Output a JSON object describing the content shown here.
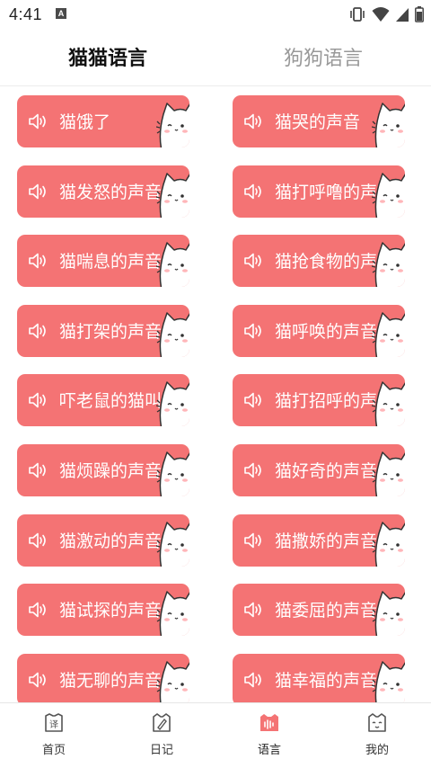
{
  "status_bar": {
    "time": "4:41",
    "notification_icon_letter": "A"
  },
  "tabs": [
    {
      "label": "猫猫语言",
      "active": true
    },
    {
      "label": "狗狗语言",
      "active": false
    }
  ],
  "sounds": [
    "猫饿了",
    "猫哭的声音",
    "猫发怒的声音",
    "猫打呼噜的声音",
    "猫喘息的声音",
    "猫抢食物的声音",
    "猫打架的声音",
    "猫呼唤的声音",
    "吓老鼠的猫叫声",
    "猫打招呼的声音",
    "猫烦躁的声音",
    "猫好奇的声音",
    "猫激动的声音",
    "猫撒娇的声音",
    "猫试探的声音",
    "猫委屈的声音",
    "猫无聊的声音",
    "猫幸福的声音"
  ],
  "bottom_nav": [
    {
      "label": "首页",
      "icon": "translate-icon",
      "active": false
    },
    {
      "label": "日记",
      "icon": "diary-icon",
      "active": false
    },
    {
      "label": "语言",
      "icon": "voice-wave-icon",
      "active": true
    },
    {
      "label": "我的",
      "icon": "cat-face-icon",
      "active": false
    }
  ],
  "colors": {
    "accent": "#f47374",
    "active_nav_icon": "#f47374"
  }
}
